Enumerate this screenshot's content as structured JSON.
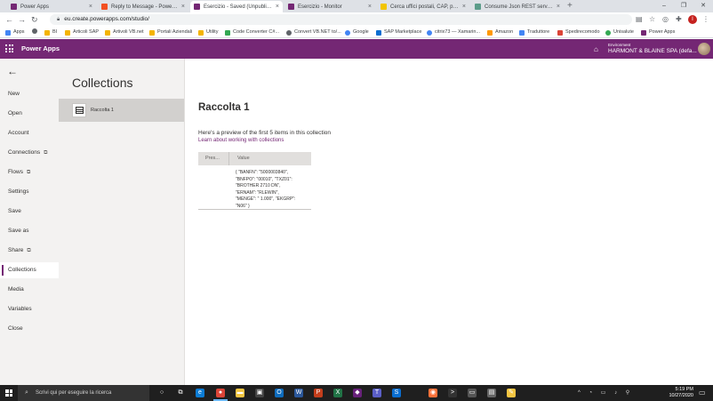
{
  "browser": {
    "tabs": [
      {
        "label": "Power Apps",
        "favicon_color": "#742774"
      },
      {
        "label": "Reply to Message - Power Platf...",
        "favicon_color": "#f25022"
      },
      {
        "label": "Esercizio - Saved (Unpublished)",
        "favicon_color": "#742774",
        "active": true
      },
      {
        "label": "Esercizio - Monitor",
        "favicon_color": "#742774"
      },
      {
        "label": "Cerca uffici postali, CAP, prodott...",
        "favicon_color": "#f2c500"
      },
      {
        "label": "Consume Json REST service with...",
        "favicon_color": "#5c9c8a"
      }
    ],
    "tab_close_glyph": "×",
    "new_tab_glyph": "+",
    "window_controls": [
      "–",
      "❐",
      "✕"
    ],
    "nav": {
      "back": "←",
      "forward": "→",
      "reload": "↻"
    },
    "url": "eu.create.powerapps.com/studio/",
    "bookmarks": [
      {
        "label": "Apps",
        "color": "#4285f4"
      },
      {
        "label": "",
        "color": "#5f6368"
      },
      {
        "label": "BI",
        "color": "#f4b400"
      },
      {
        "label": "Articoli SAP",
        "color": "#f4b400"
      },
      {
        "label": "Artivoli VB.net",
        "color": "#f4b400"
      },
      {
        "label": "Portali Aziendali",
        "color": "#f4b400"
      },
      {
        "label": "Utility",
        "color": "#f4b400"
      },
      {
        "label": "Code Converter C#...",
        "color": "#34a853"
      },
      {
        "label": "Convert VB.NET to/...",
        "color": "#5f6368"
      },
      {
        "label": "Google",
        "color": "#4285f4"
      },
      {
        "label": "SAP Marketplace",
        "color": "#0a6ed1"
      },
      {
        "label": "citrix73 — Xamarin...",
        "color": "#4285f4"
      },
      {
        "label": "Amazon",
        "color": "#ff9900"
      },
      {
        "label": "Traduttore",
        "color": "#4285f4"
      },
      {
        "label": "Spedirecomodo",
        "color": "#db4437"
      },
      {
        "label": "Unisalute",
        "color": "#34a853"
      },
      {
        "label": "Power Apps",
        "color": "#742774"
      }
    ],
    "profile_initial": "I"
  },
  "header": {
    "app_title": "Power Apps",
    "environment_label": "Environment",
    "environment_name": "HARMONT & BLAINE SPA (defa...",
    "brand_color": "#742774"
  },
  "leftnav": {
    "back_glyph": "←",
    "external_glyph": "⧉",
    "items": [
      {
        "label": "New"
      },
      {
        "label": "Open"
      },
      {
        "label": "Account"
      },
      {
        "label": "Connections",
        "external": true
      },
      {
        "label": "Flows",
        "external": true
      },
      {
        "label": "Settings"
      },
      {
        "label": "Save"
      },
      {
        "label": "Save as"
      },
      {
        "label": "Share",
        "external": true
      },
      {
        "label": "Collections",
        "selected": true
      },
      {
        "label": "Media"
      },
      {
        "label": "Variables"
      },
      {
        "label": "Close"
      }
    ]
  },
  "collections": {
    "title": "Collections",
    "items": [
      {
        "label": "Raccolta 1"
      }
    ]
  },
  "preview": {
    "title": "Raccolta 1",
    "description": "Here's a preview of the first 5 items in this collection",
    "learn_link": "Learn about working with collections",
    "columns": [
      "Pres...",
      "Value"
    ],
    "row_value": "{ \"BANFN\": \"5000003840\",\n\"BNFPO\": \"00010\", \"TXZ01\":\n\"BROTHER 2710 DN\",\n\"ERNAM\": \"RLEWIN\",\n\"MENGE\": \" 1.000\", \"EKGRP\":\n\"N06\" }"
  },
  "taskbar": {
    "search_placeholder": "Scrivi qui per eseguire la ricerca",
    "search_glyph": "⌕",
    "apps": [
      {
        "name": "cortana",
        "glyph": "○",
        "color": "transparent"
      },
      {
        "name": "task-view",
        "glyph": "⧉",
        "color": "transparent"
      },
      {
        "name": "edge",
        "glyph": "e",
        "color": "#0c7cd5"
      },
      {
        "name": "chrome",
        "glyph": "●",
        "color": "#db4437",
        "active": true
      },
      {
        "name": "explorer",
        "glyph": "▬",
        "color": "#f4c542"
      },
      {
        "name": "store",
        "glyph": "▣",
        "color": "#444"
      },
      {
        "name": "outlook",
        "glyph": "O",
        "color": "#0f6cbd"
      },
      {
        "name": "word",
        "glyph": "W",
        "color": "#2b579a"
      },
      {
        "name": "powerpoint",
        "glyph": "P",
        "color": "#c43e1c"
      },
      {
        "name": "excel",
        "glyph": "X",
        "color": "#217346"
      },
      {
        "name": "visual-studio",
        "glyph": "◆",
        "color": "#68217a"
      },
      {
        "name": "teams",
        "glyph": "T",
        "color": "#5b5fc7"
      },
      {
        "name": "sap",
        "glyph": "S",
        "color": "#0a6ed1"
      },
      {
        "name": "firefox",
        "glyph": "◉",
        "color": "#ff7139"
      },
      {
        "name": "terminal",
        "glyph": ">",
        "color": "#333"
      },
      {
        "name": "remote-desktop",
        "glyph": "▭",
        "color": "#555"
      },
      {
        "name": "sql",
        "glyph": "▤",
        "color": "#666"
      },
      {
        "name": "notes",
        "glyph": "✎",
        "color": "#f4c542"
      }
    ],
    "tray": "^ ◔ ▭ ♪ ⚲",
    "time": "5:19 PM",
    "date": "10/27/2020",
    "notification_glyph": "▭"
  }
}
